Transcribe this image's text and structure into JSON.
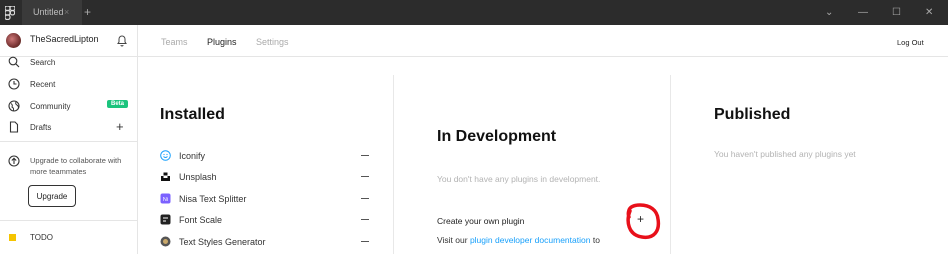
{
  "window": {
    "tab_title": "Untitled",
    "tab_close": "×",
    "new_tab": "+",
    "controls": {
      "chevron": "⌄",
      "minimize": "—",
      "maximize": "☐",
      "close": "✕"
    }
  },
  "sidebar": {
    "user": {
      "name": "TheSacredLipton"
    },
    "items": [
      {
        "label": "Search",
        "icon": "search-icon"
      },
      {
        "label": "Recent",
        "icon": "clock-icon"
      },
      {
        "label": "Community",
        "icon": "globe-icon",
        "badge": "Beta"
      },
      {
        "label": "Drafts",
        "icon": "file-icon",
        "action": "+"
      }
    ],
    "upgrade": {
      "text": "Upgrade to collaborate with more teammates",
      "button": "Upgrade"
    },
    "team": {
      "label": "TODO",
      "color": "#f5c400"
    }
  },
  "topnav": {
    "tabs": [
      {
        "label": "Teams",
        "active": false
      },
      {
        "label": "Plugins",
        "active": true
      },
      {
        "label": "Settings",
        "active": false
      }
    ],
    "logout": "Log Out"
  },
  "installed": {
    "heading": "Installed",
    "plugins": [
      {
        "name": "Iconify",
        "icon": "smiley-icon",
        "color": "#18a0fb"
      },
      {
        "name": "Unsplash",
        "icon": "unsplash-icon",
        "color": "#111111"
      },
      {
        "name": "Nisa Text Splitter",
        "icon": "nisa-icon",
        "color": "#7b61ff"
      },
      {
        "name": "Font Scale",
        "icon": "font-scale-icon",
        "color": "#222222"
      },
      {
        "name": "Text Styles Generator",
        "icon": "text-styles-icon",
        "color": "#555555"
      }
    ]
  },
  "development": {
    "heading": "In Development",
    "empty": "You don't have any plugins in development.",
    "create_label": "Create your own plugin",
    "create_action": "+",
    "visit_prefix": "Visit our",
    "visit_link": "plugin developer documentation",
    "visit_suffix": "to"
  },
  "published": {
    "heading": "Published",
    "empty": "You haven't published any plugins yet"
  },
  "colors": {
    "accent": "#18a0fb",
    "beta": "#1bc47d",
    "annotation": "#e8101a",
    "titlebar": "#2c2c2c"
  }
}
